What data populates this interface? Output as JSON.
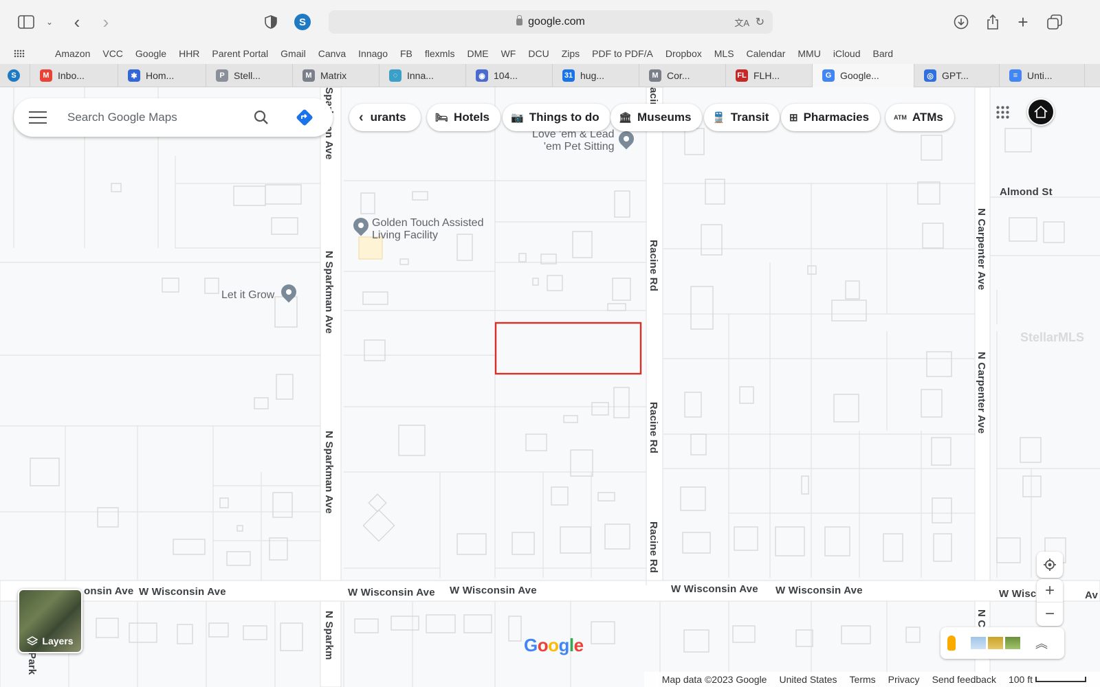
{
  "browser": {
    "url": "google.com",
    "bookmarks": [
      "Amazon",
      "VCC",
      "Google",
      "HHR",
      "Parent Portal",
      "Gmail",
      "Canva",
      "Innago",
      "FB",
      "flexmls",
      "DME",
      "WF",
      "DCU",
      "Zips",
      "PDF to PDF/A",
      "Dropbox",
      "MLS",
      "Calendar",
      "MMU",
      "iCloud",
      "Bard"
    ],
    "tabs": [
      {
        "label": "Inbo...",
        "icon": "gmail-icon",
        "color": "#ea4335",
        "glyph": "M"
      },
      {
        "label": "Hom...",
        "icon": "gear-icon",
        "color": "#3367d6",
        "glyph": "✱"
      },
      {
        "label": "Stell...",
        "icon": "stellar-icon",
        "color": "#8a8f99",
        "glyph": "P"
      },
      {
        "label": "Matrix",
        "icon": "matrix-icon",
        "color": "#7a7f8a",
        "glyph": "M"
      },
      {
        "label": "Inna...",
        "icon": "innago-icon",
        "color": "#3aa0c8",
        "glyph": "◌"
      },
      {
        "label": "104...",
        "icon": "location-icon",
        "color": "#4a6ad0",
        "glyph": "◉"
      },
      {
        "label": "hug...",
        "icon": "calendar-icon",
        "color": "#1a73e8",
        "glyph": "31"
      },
      {
        "label": "Cor...",
        "icon": "matrix-icon",
        "color": "#7a7f8a",
        "glyph": "M"
      },
      {
        "label": "FLH...",
        "icon": "flhsmv-icon",
        "color": "#c62828",
        "glyph": "FL"
      },
      {
        "label": "Google...",
        "icon": "google-icon",
        "color": "#4285f4",
        "glyph": "G"
      },
      {
        "label": "GPT...",
        "icon": "gpt-icon",
        "color": "#2f6fe0",
        "glyph": "◎"
      },
      {
        "label": "Unti...",
        "icon": "docs-icon",
        "color": "#4285f4",
        "glyph": "≡"
      }
    ],
    "active_tab_index": 9
  },
  "maps": {
    "search_placeholder": "Search Google Maps",
    "chips": [
      {
        "label": "urants",
        "icon": "restaurant-icon"
      },
      {
        "label": "Hotels",
        "icon": "hotel-icon"
      },
      {
        "label": "Things to do",
        "icon": "camera-icon"
      },
      {
        "label": "Museums",
        "icon": "museum-icon"
      },
      {
        "label": "Transit",
        "icon": "transit-icon"
      },
      {
        "label": "Pharmacies",
        "icon": "pharmacy-icon"
      },
      {
        "label": "ATMs",
        "icon": "atm-icon"
      }
    ],
    "streets": {
      "sparkman_top": "Sparkman Ave",
      "sparkman_mid": "N Sparkman Ave",
      "sparkman_low": "N Sparkman Ave",
      "sparkman_bottom": "N Sparkm",
      "racine_1": "Racine Rd",
      "racine_2": "Racine Rd",
      "racine_3": "Racine Rd",
      "racine_top": "acir",
      "carpenter_1": "N Carpenter Ave",
      "carpenter_2": "N Carpenter Ave",
      "carpenter_bottom": "N C",
      "almond": "Almond St",
      "wisconsin_1": "onsin Ave",
      "wisconsin_2": "W Wisconsin Ave",
      "wisconsin_3": "W Wisconsin Ave",
      "wisconsin_4": "W Wisconsin Ave",
      "wisconsin_5": "W Wisconsin Ave",
      "wisconsin_6": "W Wisconsin Ave",
      "wisconsin_7": "W Wisc",
      "wisconsin_8": "Av",
      "park_left": "Park"
    },
    "pois": {
      "love_em": "Love 'em & Lead\n'em Pet Sitting",
      "golden_touch": "Golden Touch Assisted\nLiving Facility",
      "let_it_grow": "Let it Grow"
    },
    "watermark": "StellarMLS",
    "layers_label": "Layers",
    "footer": {
      "map_data": "Map data ©2023 Google",
      "country": "United States",
      "terms": "Terms",
      "privacy": "Privacy",
      "feedback": "Send feedback",
      "scale": "100 ft"
    },
    "logo": "Google",
    "highlight_color": "#d93025"
  }
}
